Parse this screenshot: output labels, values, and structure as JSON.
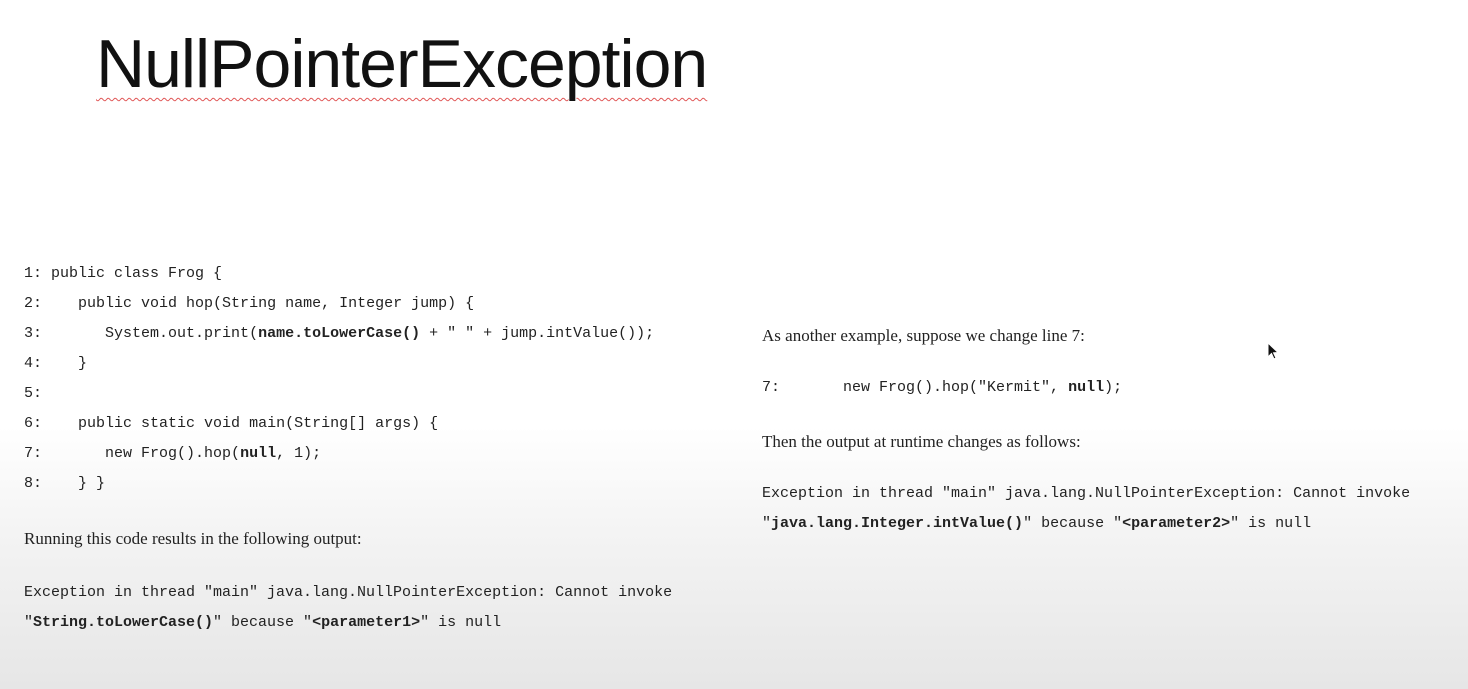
{
  "title": "NullPointerException",
  "left": {
    "code_lines": [
      {
        "num": "1:",
        "parts": [
          {
            "t": "public class Frog {"
          }
        ]
      },
      {
        "num": "2:",
        "parts": [
          {
            "t": "   public void hop(String name, Integer jump) {"
          }
        ]
      },
      {
        "num": "3:",
        "parts": [
          {
            "t": "      System.out.print("
          },
          {
            "t": "name.toLowerCase()",
            "b": true
          },
          {
            "t": " + \" \" + jump.intValue());"
          }
        ]
      },
      {
        "num": "4:",
        "parts": [
          {
            "t": "   }"
          }
        ]
      },
      {
        "num": "5:",
        "parts": []
      },
      {
        "num": "6:",
        "parts": [
          {
            "t": "   public static void main(String[] args) {"
          }
        ]
      },
      {
        "num": "7:",
        "parts": [
          {
            "t": "      new Frog().hop("
          },
          {
            "t": "null",
            "b": true
          },
          {
            "t": ", 1);"
          }
        ]
      },
      {
        "num": "8:",
        "parts": [
          {
            "t": "   } }"
          }
        ]
      }
    ],
    "result_text": "Running this code results in the following output:",
    "output_lines": [
      [
        {
          "t": "Exception in thread \"main\" java.lang.NullPointerException: Cannot invoke"
        }
      ],
      [
        {
          "t": "\""
        },
        {
          "t": "String.toLowerCase()",
          "b": true
        },
        {
          "t": "\" because \""
        },
        {
          "t": "<parameter1>",
          "b": true
        },
        {
          "t": "\" is null"
        }
      ]
    ]
  },
  "right": {
    "intro_text": "As another example, suppose we change line 7:",
    "code_lines": [
      [
        {
          "t": "7:       new Frog().hop(\"Kermit\", "
        },
        {
          "t": "null",
          "b": true
        },
        {
          "t": ");"
        }
      ]
    ],
    "then_text": "Then the output at runtime changes as follows:",
    "output_lines": [
      [
        {
          "t": "Exception in thread \"main\" java.lang.NullPointerException: Cannot invoke"
        }
      ],
      [
        {
          "t": "\""
        },
        {
          "t": "java.lang.Integer.intValue()",
          "b": true
        },
        {
          "t": "\" because \""
        },
        {
          "t": "<parameter2>",
          "b": true
        },
        {
          "t": "\" is null"
        }
      ]
    ]
  }
}
